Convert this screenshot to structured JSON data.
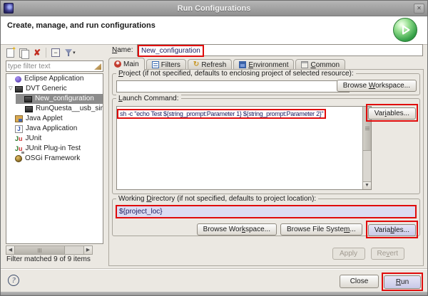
{
  "window": {
    "title": "Run Configurations"
  },
  "header": {
    "title": "Create, manage, and run configurations"
  },
  "icons": {
    "close": "✕",
    "new_star": "✦",
    "delete": "✘",
    "collapse": "−",
    "menu_arrow": "▾",
    "expander": "▽",
    "main_tab": "✱",
    "refresh_tab": "↻",
    "java_j": "J",
    "junit_j": "J",
    "junit_u": "u",
    "scroll_left": "◀",
    "scroll_right": "▶",
    "scroll_down": "▼",
    "help": "?"
  },
  "sidebar": {
    "filter_placeholder": "type filter text",
    "tree": [
      {
        "label": "Eclipse Application"
      },
      {
        "label": "DVT Generic"
      },
      {
        "label": "New_configuration"
      },
      {
        "label": "RunQuesta__usb_sim_mo"
      },
      {
        "label": "Java Applet"
      },
      {
        "label": "Java Application"
      },
      {
        "label": "JUnit"
      },
      {
        "label": "JUnit Plug-in Test"
      },
      {
        "label": "OSGi Framework"
      }
    ],
    "status": "Filter matched 9 of 9 items"
  },
  "form": {
    "name_label": "Name:",
    "name_value": "New_configuration",
    "tabs": [
      {
        "label": "Main"
      },
      {
        "label": "Filters"
      },
      {
        "label": "Refresh"
      },
      {
        "label": "Environment"
      },
      {
        "label": "Common"
      }
    ],
    "project": {
      "group_label": "Project (if not specified, defaults to enclosing project of selected resource):",
      "value": "",
      "browse_workspace": "Browse Workspace..."
    },
    "launch": {
      "group_label": "Launch Command:",
      "command": "sh -c \"echo Test ${string_prompt:Parameter 1} ${string_prompt:Parameter 2}\"",
      "variables": "Variables..."
    },
    "workdir": {
      "group_label": "Working Directory (if not specified, defaults to project location):",
      "value": "${project_loc}",
      "browse_workspace": "Browse Workspace...",
      "browse_filesystem": "Browse File System...",
      "variables": "Variables..."
    },
    "apply": "Apply",
    "revert": "Revert"
  },
  "footer": {
    "close": "Close",
    "run": "Run"
  }
}
